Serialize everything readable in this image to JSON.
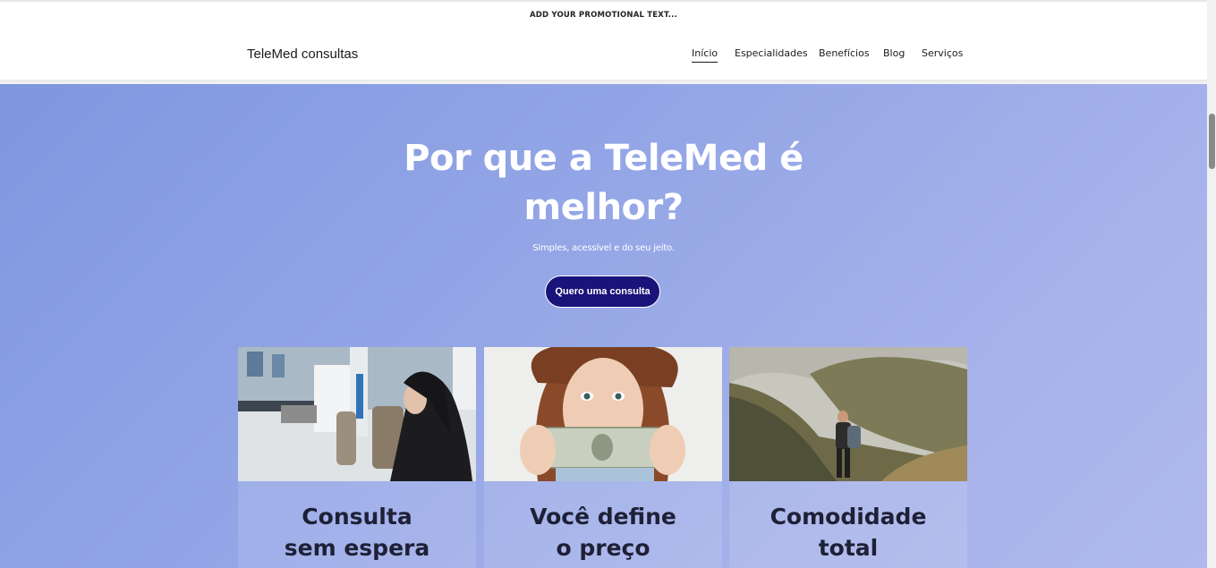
{
  "promo": {
    "text": "ADD YOUR PROMOTIONAL TEXT..."
  },
  "header": {
    "brand": "TeleMed consultas",
    "nav": [
      "Início",
      "Especialidades",
      "Benefícios",
      "Blog",
      "Serviços"
    ],
    "active_index": 0
  },
  "hero": {
    "title_line1": "Por que a TeleMed é",
    "title_line2": "melhor?",
    "subtitle": "Simples, acessível e do seu jeito.",
    "cta_label": "Quero uma consulta"
  },
  "cards": [
    {
      "line1": "Consulta",
      "line2": "sem espera",
      "image": "clinic-waiting-room"
    },
    {
      "line1": "Você define",
      "line2": "o preço",
      "image": "woman-holding-dollar-bill"
    },
    {
      "line1": "Comodidade",
      "line2": "total",
      "image": "hiker-in-mountains"
    }
  ],
  "colors": {
    "hero_gradient_start": "#7f97e0",
    "hero_gradient_end": "#afb9ec",
    "cta_background": "#1a137a",
    "text_dark": "#1e2036"
  }
}
